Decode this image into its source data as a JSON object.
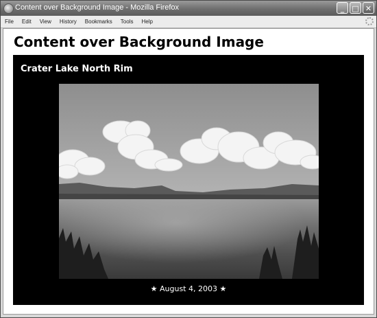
{
  "window": {
    "title": "Content over Background Image - Mozilla Firefox",
    "buttons": {
      "minimize": "_",
      "maximize": "□",
      "close": "✕"
    }
  },
  "menu": {
    "items": [
      "File",
      "Edit",
      "View",
      "History",
      "Bookmarks",
      "Tools",
      "Help"
    ]
  },
  "page": {
    "heading": "Content over Background Image",
    "panel_title": "Crater Lake North Rim",
    "caption": {
      "star_left": "★",
      "text": "August 4, 2003",
      "star_right": "★"
    },
    "photo_subject": "crater-lake-photo"
  },
  "colors": {
    "panel_background": "#000000",
    "page_background": "#ffffff",
    "titlebar": "#6e6e6e"
  }
}
